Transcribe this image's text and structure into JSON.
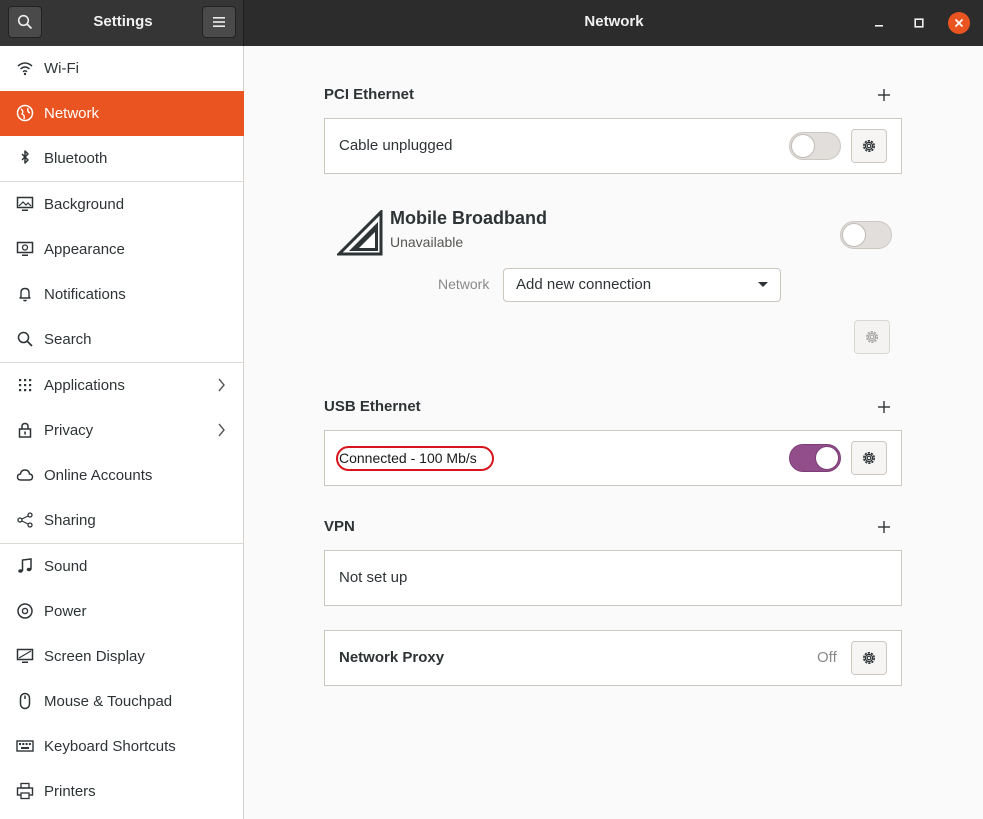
{
  "header": {
    "sidebar_title": "Settings",
    "main_title": "Network"
  },
  "colors": {
    "accent": "#e95420",
    "toggle_on": "#924d8b",
    "highlight": "#d8151c"
  },
  "sidebar": {
    "items": [
      {
        "label": "Wi-Fi",
        "icon": "wifi-icon"
      },
      {
        "label": "Network",
        "icon": "network-icon",
        "active": true
      },
      {
        "label": "Bluetooth",
        "icon": "bluetooth-icon"
      },
      {
        "label": "Background",
        "icon": "background-icon"
      },
      {
        "label": "Appearance",
        "icon": "appearance-icon"
      },
      {
        "label": "Notifications",
        "icon": "bell-icon"
      },
      {
        "label": "Search",
        "icon": "search-icon"
      },
      {
        "label": "Applications",
        "icon": "applications-icon"
      },
      {
        "label": "Privacy",
        "icon": "lock-icon"
      },
      {
        "label": "Online Accounts",
        "icon": "cloud-icon"
      },
      {
        "label": "Sharing",
        "icon": "share-icon"
      },
      {
        "label": "Sound",
        "icon": "music-note-icon"
      },
      {
        "label": "Power",
        "icon": "power-icon"
      },
      {
        "label": "Screen Display",
        "icon": "display-icon"
      },
      {
        "label": "Mouse & Touchpad",
        "icon": "mouse-icon"
      },
      {
        "label": "Keyboard Shortcuts",
        "icon": "keyboard-icon"
      },
      {
        "label": "Printers",
        "icon": "printer-icon"
      }
    ]
  },
  "main": {
    "pci": {
      "title": "PCI Ethernet",
      "status": "Cable unplugged",
      "enabled": false
    },
    "mobile": {
      "title": "Mobile Broadband",
      "status": "Unavailable",
      "enabled": false,
      "network_label": "Network",
      "network_value": "Add new connection"
    },
    "usb": {
      "title": "USB Ethernet",
      "status": "Connected - 100 Mb/s",
      "enabled": true
    },
    "vpn": {
      "title": "VPN",
      "status": "Not set up"
    },
    "proxy": {
      "title": "Network Proxy",
      "status": "Off"
    }
  }
}
